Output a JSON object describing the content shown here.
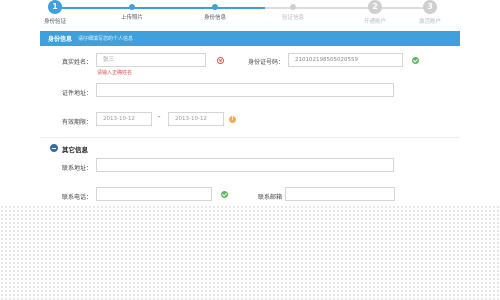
{
  "steps": [
    {
      "num": "1",
      "label": "身份验证",
      "state": "done"
    },
    {
      "num": "",
      "label": "上传照片",
      "state": "done"
    },
    {
      "num": "",
      "label": "身份信息",
      "state": "current"
    },
    {
      "num": "",
      "label": "验证信息",
      "state": "todo"
    },
    {
      "num": "2",
      "label": "开通账户",
      "state": "todo"
    },
    {
      "num": "3",
      "label": "激活账户",
      "state": "todo"
    }
  ],
  "section": {
    "title": "身份信息",
    "subtitle": "请仔细填写您的个人信息"
  },
  "form": {
    "name_label": "真实姓名：",
    "name_value": "张三",
    "name_error": "请输入正确姓名",
    "id_label": "身份证号码：",
    "id_value": "210102198505020559",
    "address_label": "证件地址：",
    "address_value": "",
    "validity_label": "有效期限：",
    "validity_from": "2013-10-12",
    "validity_to": "2013-10-12",
    "validity_sep": "-",
    "warn_glyph": "!"
  },
  "other": {
    "title": "其它信息",
    "contact_address_label": "联系地址：",
    "contact_address_value": "",
    "phone_label": "联系电话：",
    "phone_value": "",
    "email_label": "联系邮箱"
  },
  "colors": {
    "accent": "#3ea0dd",
    "error": "#d9534f",
    "ok": "#5cb85c",
    "warn": "#f0ad4e"
  }
}
